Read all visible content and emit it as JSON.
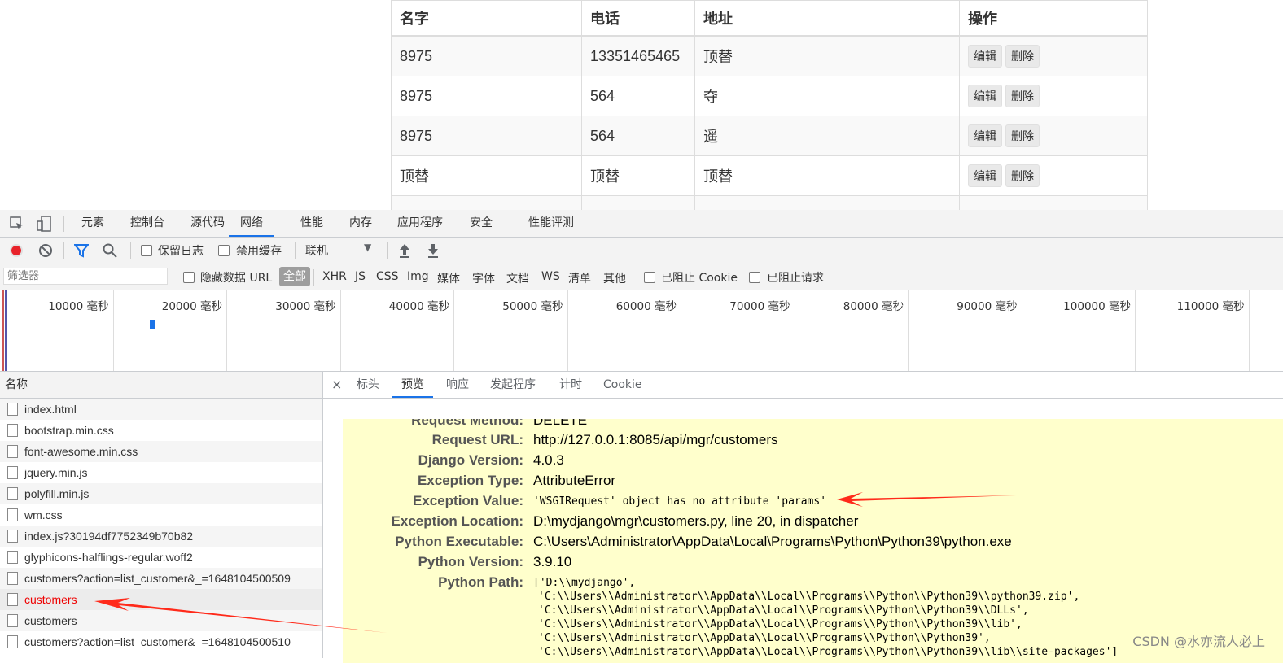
{
  "table": {
    "headers": [
      "名字",
      "电话",
      "地址",
      "操作"
    ],
    "rows": [
      {
        "name": "8975",
        "phone": "13351465465",
        "address": "顶替"
      },
      {
        "name": "8975",
        "phone": "564",
        "address": "夺"
      },
      {
        "name": "8975",
        "phone": "564",
        "address": "遥"
      },
      {
        "name": "顶替",
        "phone": "顶替",
        "address": "顶替"
      }
    ],
    "edit_label": "编辑",
    "delete_label": "删除"
  },
  "devtools": {
    "tabs": [
      "元素",
      "控制台",
      "源代码",
      "网络",
      "性能",
      "内存",
      "应用程序",
      "安全",
      "性能评测"
    ],
    "active_tab": "网络",
    "toolbar": {
      "preserve_log": "保留日志",
      "disable_cache": "禁用缓存",
      "throttle": "联机"
    },
    "filter": {
      "placeholder": "筛选器",
      "hide_data_url": "隐藏数据 URL",
      "all": "全部",
      "types": [
        "XHR",
        "JS",
        "CSS",
        "Img",
        "媒体",
        "字体",
        "文档",
        "WS",
        "清单",
        "其他"
      ],
      "blocked_cookies": "已阻止 Cookie",
      "blocked_requests": "已阻止请求"
    },
    "timeline_ticks": [
      "10000 毫秒",
      "20000 毫秒",
      "30000 毫秒",
      "40000 毫秒",
      "50000 毫秒",
      "60000 毫秒",
      "70000 毫秒",
      "80000 毫秒",
      "90000 毫秒",
      "100000 毫秒",
      "110000 毫秒"
    ],
    "request_list": {
      "header": "名称",
      "items": [
        "index.html",
        "bootstrap.min.css",
        "font-awesome.min.css",
        "jquery.min.js",
        "polyfill.min.js",
        "wm.css",
        "index.js?30194df7752349b70b82",
        "glyphicons-halflings-regular.woff2",
        "customers?action=list_customer&_=1648104500509",
        "customers",
        "customers",
        "customers?action=list_customer&_=1648104500510"
      ]
    },
    "detail_tabs": [
      "标头",
      "预览",
      "响应",
      "发起程序",
      "计时",
      "Cookie"
    ],
    "active_detail_tab": "预览",
    "preview": {
      "rows": [
        {
          "key": "Request Method:",
          "value": "DELETE"
        },
        {
          "key": "Request URL:",
          "value": "http://127.0.0.1:8085/api/mgr/customers"
        },
        {
          "key": "Django Version:",
          "value": "4.0.3"
        },
        {
          "key": "Exception Type:",
          "value": "AttributeError"
        },
        {
          "key": "Exception Value:",
          "value": "'WSGIRequest' object has no attribute 'params'"
        },
        {
          "key": "Exception Location:",
          "value": "D:\\mydjango\\mgr\\customers.py, line 20, in dispatcher"
        },
        {
          "key": "Python Executable:",
          "value": "C:\\Users\\Administrator\\AppData\\Local\\Programs\\Python\\Python39\\python.exe"
        },
        {
          "key": "Python Version:",
          "value": "3.9.10"
        },
        {
          "key": "Python Path:",
          "value": "['D:\\\\mydjango',"
        }
      ],
      "python_path_more": [
        " 'C:\\\\Users\\\\Administrator\\\\AppData\\\\Local\\\\Programs\\\\Python\\\\Python39\\\\python39.zip',",
        " 'C:\\\\Users\\\\Administrator\\\\AppData\\\\Local\\\\Programs\\\\Python\\\\Python39\\\\DLLs',",
        " 'C:\\\\Users\\\\Administrator\\\\AppData\\\\Local\\\\Programs\\\\Python\\\\Python39\\\\lib',",
        " 'C:\\\\Users\\\\Administrator\\\\AppData\\\\Local\\\\Programs\\\\Python\\\\Python39',",
        " 'C:\\\\Users\\\\Administrator\\\\AppData\\\\Local\\\\Programs\\\\Python\\\\Python39\\\\lib\\\\site-packages']"
      ]
    }
  },
  "watermark": "CSDN @水亦流人必上",
  "colors": {
    "accent": "#1a73e8",
    "error": "#ee0000",
    "preview_bg": "#ffffcc",
    "annotation_arrow": "#ff2a1a"
  }
}
